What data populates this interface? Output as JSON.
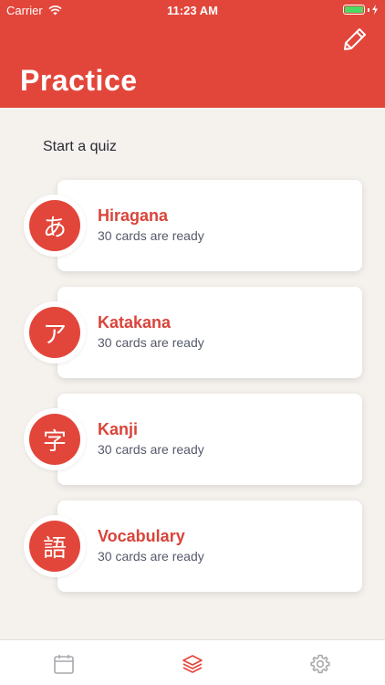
{
  "status_bar": {
    "carrier": "Carrier",
    "time": "11:23 AM"
  },
  "header": {
    "title": "Practice",
    "edit_icon": "pencil-icon"
  },
  "section": {
    "label": "Start a quiz"
  },
  "cards": [
    {
      "glyph": "あ",
      "title": "Hiragana",
      "subtitle": "30 cards are ready"
    },
    {
      "glyph": "ア",
      "title": "Katakana",
      "subtitle": "30 cards are ready"
    },
    {
      "glyph": "字",
      "title": "Kanji",
      "subtitle": "30 cards are ready"
    },
    {
      "glyph": "語",
      "title": "Vocabulary",
      "subtitle": "30 cards are ready"
    }
  ],
  "tab_bar": {
    "tabs": [
      {
        "icon": "calendar-icon",
        "active": false
      },
      {
        "icon": "layers-icon",
        "active": true
      },
      {
        "icon": "gear-icon",
        "active": false
      }
    ]
  },
  "colors": {
    "accent": "#e2463a",
    "background": "#f5f2ee",
    "battery": "#4cd964"
  }
}
